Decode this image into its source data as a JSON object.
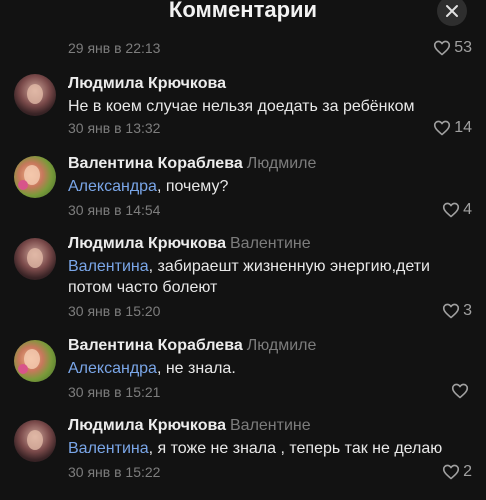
{
  "header": {
    "title": "Комментарии"
  },
  "top_meta": {
    "date": "29 янв в 22:13",
    "likes": "53"
  },
  "comments": [
    {
      "author": "Людмила Крючкова",
      "reply_to": "",
      "mention": "",
      "text": "Не в коем случае нельзя доедать за ребёнком",
      "date": "30 янв в 13:32",
      "likes": "14"
    },
    {
      "author": "Валентина Кораблева",
      "reply_to": "Людмиле",
      "mention": "Александра",
      "text": ", почему?",
      "date": "30 янв в 14:54",
      "likes": "4"
    },
    {
      "author": "Людмила Крючкова",
      "reply_to": "Валентине",
      "mention": "Валентина",
      "text": ", забираешт жизненную энергию,дети потом часто болеют",
      "date": "30 янв в 15:20",
      "likes": "3"
    },
    {
      "author": "Валентина Кораблева",
      "reply_to": "Людмиле",
      "mention": "Александра",
      "text": ", не знала.",
      "date": "30 янв в 15:21",
      "likes": ""
    },
    {
      "author": "Людмила Крючкова",
      "reply_to": "Валентине",
      "mention": "Валентина",
      "text": ", я тоже не знала , теперь так не делаю",
      "date": "30 янв в 15:22",
      "likes": "2"
    }
  ],
  "icons": {
    "close": "close-icon",
    "like": "heart-outline-icon"
  },
  "colors": {
    "background": "#121212",
    "mention": "#7aa6e8",
    "muted": "#7d7d7d"
  }
}
